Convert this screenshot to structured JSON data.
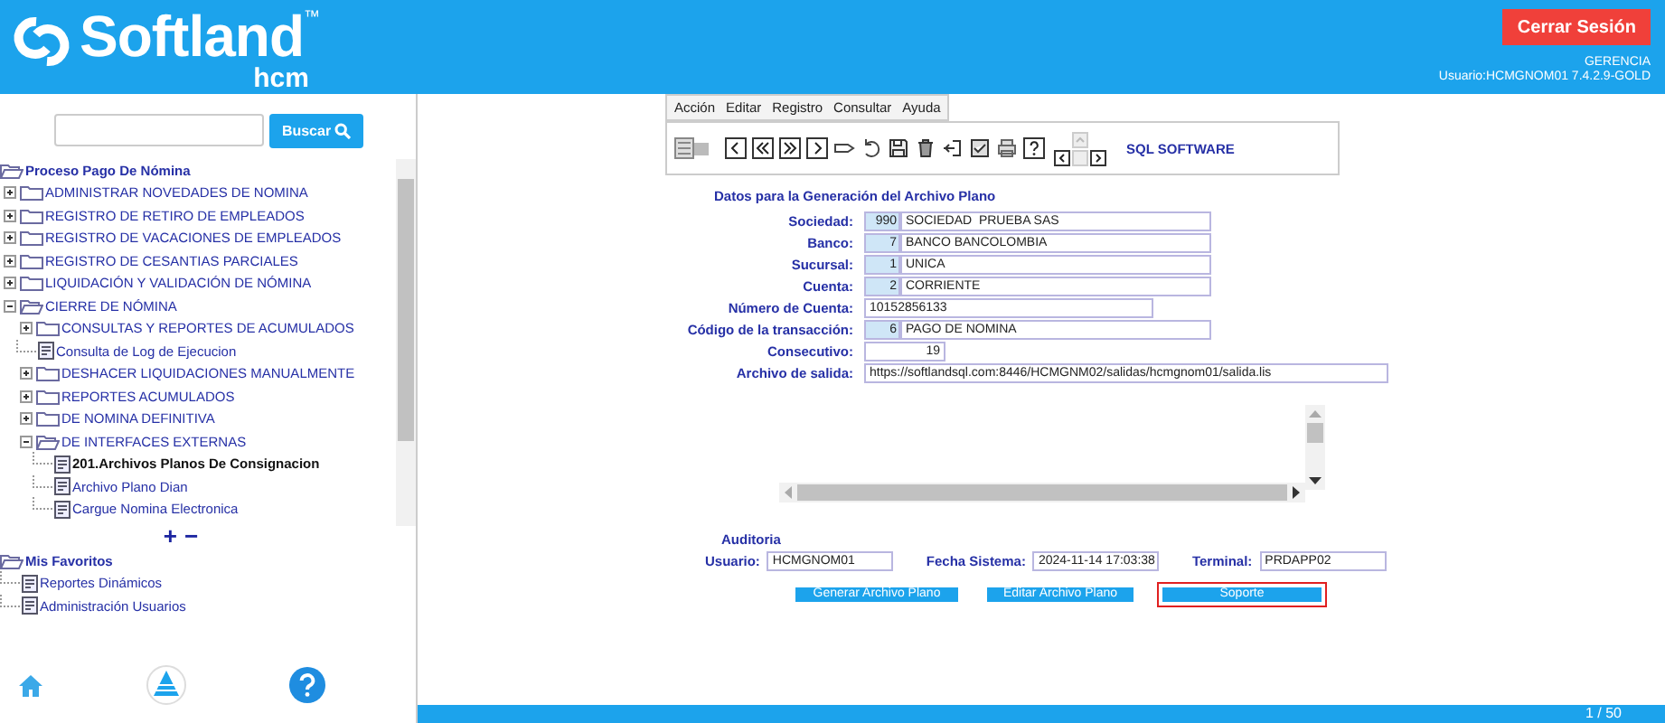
{
  "header": {
    "brand": "Softland",
    "trademark": "™",
    "product": "hcm",
    "logout_button": "Cerrar Sesión",
    "role": "GERENCIA",
    "user_line": "Usuario:HCMGNOM01 7.4.2.9-GOLD"
  },
  "sidebar": {
    "search": {
      "button": "Buscar"
    },
    "tree": [
      {
        "label": "Proceso Pago De Nómina",
        "kind": "folder",
        "expanded": true,
        "selected": false,
        "children": [
          {
            "label": "ADMINISTRAR NOVEDADES DE NOMINA",
            "kind": "folder",
            "expanded": false,
            "selected": false
          },
          {
            "label": "REGISTRO DE RETIRO DE EMPLEADOS",
            "kind": "folder",
            "expanded": false,
            "selected": false
          },
          {
            "label": "REGISTRO DE VACACIONES DE EMPLEADOS",
            "kind": "folder",
            "expanded": false,
            "selected": false
          },
          {
            "label": "REGISTRO DE CESANTIAS PARCIALES",
            "kind": "folder",
            "expanded": false,
            "selected": false
          },
          {
            "label": "LIQUIDACIÓN Y VALIDACIÓN DE NÓMINA",
            "kind": "folder",
            "expanded": false,
            "selected": false
          },
          {
            "label": "CIERRE DE NÓMINA",
            "kind": "folder",
            "expanded": true,
            "selected": false,
            "children": [
              {
                "label": "CONSULTAS Y REPORTES DE ACUMULADOS",
                "kind": "folder",
                "expanded": false,
                "selected": false
              },
              {
                "label": "Consulta de Log de Ejecucion",
                "kind": "doc",
                "selected": false
              },
              {
                "label": "DESHACER LIQUIDACIONES MANUALMENTE",
                "kind": "folder",
                "expanded": false,
                "selected": false
              },
              {
                "label": "REPORTES ACUMULADOS",
                "kind": "folder",
                "expanded": false,
                "selected": false
              },
              {
                "label": "DE NOMINA DEFINITIVA",
                "kind": "folder",
                "expanded": false,
                "selected": false
              },
              {
                "label": "DE INTERFACES EXTERNAS",
                "kind": "folder",
                "expanded": true,
                "selected": false,
                "children": [
                  {
                    "label": "201.Archivos Planos De Consignacion",
                    "kind": "doc",
                    "selected": true
                  },
                  {
                    "label": "Archivo Plano Dian",
                    "kind": "doc",
                    "selected": false
                  },
                  {
                    "label": "Cargue Nomina Electronica",
                    "kind": "doc",
                    "selected": false
                  }
                ]
              }
            ]
          }
        ]
      }
    ],
    "expand_all": "+",
    "collapse_all": "−",
    "favorites": [
      {
        "label": "Mis Favoritos",
        "kind": "folder",
        "expanded": true,
        "selected": false,
        "children": [
          {
            "label": "Reportes Dinámicos",
            "kind": "doc",
            "selected": false
          },
          {
            "label": "Administración Usuarios",
            "kind": "doc",
            "selected": false
          }
        ]
      }
    ]
  },
  "form": {
    "menu": [
      "Acción",
      "Editar",
      "Registro",
      "Consultar",
      "Ayuda"
    ],
    "toolbar_label": "SQL SOFTWARE",
    "section_title": "Datos para la Generación del Archivo Plano",
    "fields": [
      {
        "kind": "coded",
        "label": "Sociedad:",
        "code": "990",
        "value": "SOCIEDAD  PRUEBA SAS"
      },
      {
        "kind": "coded",
        "label": "Banco:",
        "code": "7",
        "value": "BANCO BANCOLOMBIA"
      },
      {
        "kind": "coded",
        "label": "Sucursal:",
        "code": "1",
        "value": "UNICA"
      },
      {
        "kind": "coded",
        "label": "Cuenta:",
        "code": "2",
        "value": "CORRIENTE"
      },
      {
        "kind": "text",
        "label": "Número de Cuenta:",
        "value": "10152856133"
      },
      {
        "kind": "coded",
        "label": "Código de la transacción:",
        "code": "6",
        "value": "PAGO DE NOMINA"
      },
      {
        "kind": "number",
        "label": "Consecutivo:",
        "value": "19"
      },
      {
        "kind": "long",
        "label": "Archivo de salida:",
        "value": "https://softlandsql.com:8446/HCMGNM02/salidas/hcmgnom01/salida.lis"
      }
    ],
    "audit": {
      "title": "Auditoria",
      "fields": [
        {
          "label": "Usuario:",
          "value": "HCMGNOM01"
        },
        {
          "label": "Fecha Sistema:",
          "value": "2024-11-14 17:03:38"
        },
        {
          "label": "Terminal:",
          "value": "PRDAPP02"
        }
      ]
    },
    "buttons": [
      {
        "label": "Generar Archivo Plano",
        "highlighted": false
      },
      {
        "label": "Editar Archivo Plano",
        "highlighted": false
      },
      {
        "label": "Soporte",
        "highlighted": true
      }
    ]
  },
  "status_bar": {
    "page": "1 / 50"
  }
}
